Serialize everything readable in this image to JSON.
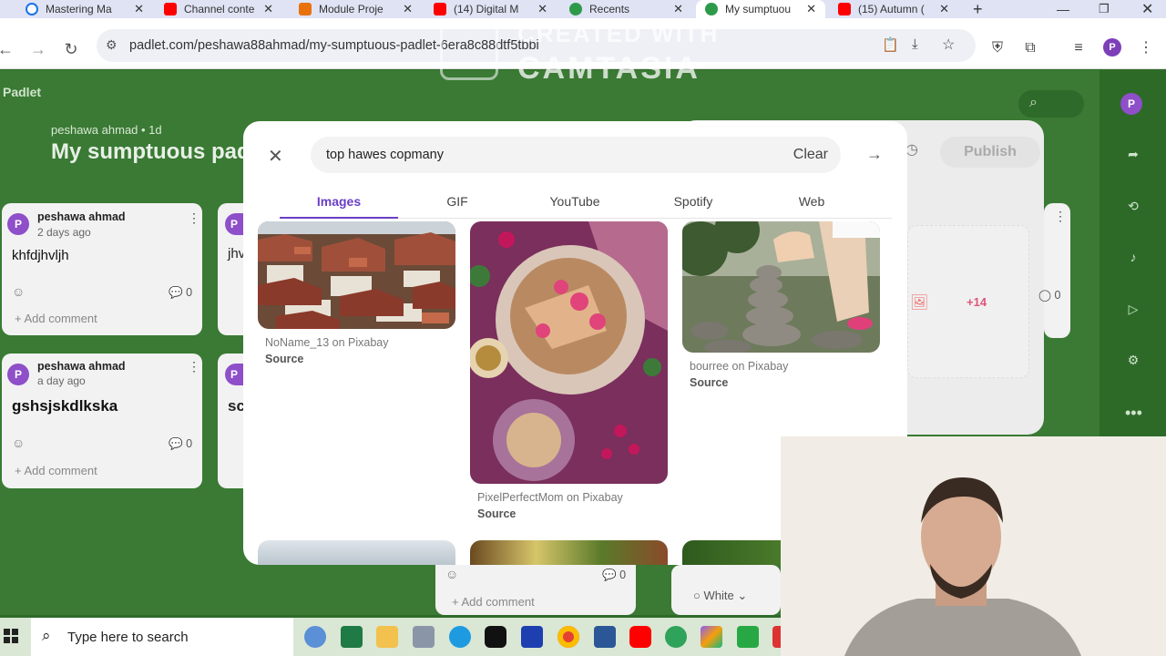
{
  "browser": {
    "tabs": [
      {
        "title": "Mastering Ma",
        "icon": "google-icon",
        "color": "#1a73e8"
      },
      {
        "title": "Channel conte",
        "icon": "youtube-icon",
        "color": "#ff0000"
      },
      {
        "title": "Module Proje",
        "icon": "document-icon",
        "color": "#e8710a"
      },
      {
        "title": "(14) Digital M",
        "icon": "youtube-icon",
        "color": "#ff0000"
      },
      {
        "title": "Recents",
        "icon": "padlet-icon",
        "color": "#2d9a4a"
      },
      {
        "title": "My sumptuou",
        "icon": "padlet-icon",
        "color": "#2d9a4a",
        "active": true
      },
      {
        "title": "(15) Autumn (",
        "icon": "youtube-icon",
        "color": "#ff0000"
      }
    ],
    "new_tab": "+",
    "url": "padlet.com/peshawa88ahmad/my-sumptuous-padlet-6era8c88dtf5tbbi",
    "profile_initial": "P"
  },
  "watermark": {
    "line1": "CREATED WITH",
    "line2": "CAMTASIA"
  },
  "padlet": {
    "logo": "Padlet",
    "author_line": "peshawa ahmad • 1d",
    "title": "My sumptuous pad",
    "publish_label": "Publish",
    "user_initial": "P",
    "cards": [
      {
        "author": "peshawa ahmad",
        "time": "2 days ago",
        "text": "khfdjhvljh",
        "comments": "0",
        "add_comment": "Add comment"
      },
      {
        "author": "peshawa ahmad",
        "time": "a day ago",
        "text": "gshsjskdlkska",
        "comments": "0",
        "add_comment": "Add comment"
      }
    ],
    "partial_card_texts": [
      "jhv",
      "sc"
    ],
    "partial_card_avatar": "P",
    "bottom_card": {
      "comments": "0",
      "add_comment": "Add comment"
    },
    "white_label": "White",
    "right_card": {
      "comments": "0",
      "more": "+14"
    }
  },
  "modal": {
    "search_value": "top hawes copmany",
    "clear_label": "Clear",
    "tabs": [
      "Images",
      "GIF",
      "YouTube",
      "Spotify",
      "Web"
    ],
    "active_tab": "Images",
    "results": [
      {
        "caption": "NoName_13 on Pixabay",
        "source": "Source"
      },
      {
        "caption": "PixelPerfectMom on Pixabay",
        "source": "Source"
      },
      {
        "caption": "bourree on Pixabay",
        "source": "Source"
      }
    ]
  },
  "taskbar": {
    "search_placeholder": "Type here to search",
    "apps": [
      "edge-icon",
      "excel-icon",
      "file-explorer-icon",
      "keyboard-icon",
      "edge-icon",
      "tiktok-icon",
      "l-app-icon",
      "chrome-icon",
      "word-icon",
      "youtube-icon",
      "edge-beta-icon",
      "copilot-icon",
      "camtasia-icon"
    ]
  }
}
